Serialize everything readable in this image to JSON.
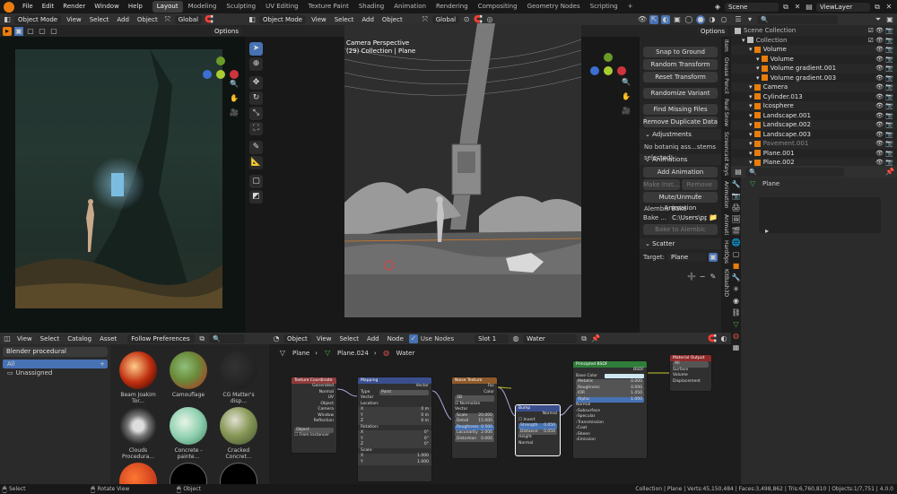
{
  "menus": [
    "File",
    "Edit",
    "Render",
    "Window",
    "Help"
  ],
  "workspaces": [
    "Layout",
    "Modeling",
    "Sculpting",
    "UV Editing",
    "Texture Paint",
    "Shading",
    "Animation",
    "Rendering",
    "Compositing",
    "Geometry Nodes",
    "Scripting"
  ],
  "active_workspace": "Layout",
  "add_tab": "+",
  "scene": {
    "name": "Scene",
    "view_layer": "ViewLayer"
  },
  "left_viewport": {
    "mode": "Object Mode",
    "menus": [
      "View",
      "Select",
      "Add",
      "Object"
    ],
    "transform": "Global",
    "options": "Options"
  },
  "main_viewport": {
    "mode": "Object Mode",
    "menus": [
      "View",
      "Select",
      "Add",
      "Object"
    ],
    "transform": "Global",
    "options": "Options",
    "camera_label": "Camera Perspective",
    "collection_label": "(29) Collection | Plane"
  },
  "npanel": {
    "buttons1": [
      "Snap to Ground",
      "Random Transform",
      "Reset Transform"
    ],
    "randomize": "Randomize Variant",
    "buttons2": [
      "Find Missing Files",
      "Remove Duplicate Data"
    ],
    "adjustments": "Adjustments",
    "no_assets": "No botaniq ass...stems selected!",
    "animations": "Animations",
    "add_animation": "Add Animation",
    "make_inst": "Make Inst...",
    "remove_a": "Remove A...",
    "mute_unmute": "Mute/Unmute Animation",
    "alembic_bake": "Alembic Bake",
    "bake_label": "Bake ...",
    "bake_path": "C:\\Users\\pplao\\b...",
    "bake_to_alembic": "Bake to Alembic",
    "scatter": "Scatter",
    "target_label": "Target:",
    "target_value": "Plane",
    "tabs": [
      "Item",
      "Grease Pencil",
      "Real Snow",
      "Screencast Keys",
      "Animation",
      "Animati",
      "HardOps",
      "KitBash3D"
    ]
  },
  "outliner": {
    "search_placeholder": "",
    "rows": [
      {
        "label": "Scene Collection",
        "indent": 0,
        "color": "#bbbbbb"
      },
      {
        "label": "Collection",
        "indent": 1,
        "color": "#bbbbbb"
      },
      {
        "label": "Volume",
        "indent": 2,
        "color": "#e0e0e0"
      },
      {
        "label": "Volume",
        "indent": 3,
        "color": "#e0e0e0"
      },
      {
        "label": "Volume gradient.001",
        "indent": 3,
        "color": "#e0e0e0"
      },
      {
        "label": "Volume gradient.003",
        "indent": 3,
        "color": "#e0e0e0"
      },
      {
        "label": "Camera",
        "indent": 2,
        "color": "#e0e0e0"
      },
      {
        "label": "Cylinder.013",
        "indent": 2,
        "color": "#e0e0e0"
      },
      {
        "label": "Icosphere",
        "indent": 2,
        "color": "#e0e0e0"
      },
      {
        "label": "Landscape.001",
        "indent": 2,
        "color": "#e0e0e0"
      },
      {
        "label": "Landscape.002",
        "indent": 2,
        "color": "#e0e0e0"
      },
      {
        "label": "Landscape.003",
        "indent": 2,
        "color": "#e0e0e0"
      },
      {
        "label": "Pavement.001",
        "indent": 2,
        "color": "#888888"
      },
      {
        "label": "Plane.001",
        "indent": 2,
        "color": "#e0e0e0"
      },
      {
        "label": "Plane.002",
        "indent": 2,
        "color": "#e0e0e0"
      }
    ]
  },
  "properties": {
    "object_name": "Plane"
  },
  "asset_browser": {
    "menus": [
      "View",
      "Select",
      "Catalog",
      "Asset"
    ],
    "library": "Follow Preferences",
    "source": "Blender procedural",
    "catalogs": [
      "All",
      "Unassigned"
    ],
    "assets": [
      "Beam Joakim Tor...",
      "Camouflage",
      "CG Matter's disp...",
      "Clouds Procedura...",
      "Concrete - painte...",
      "Cracked Concret..."
    ]
  },
  "node_editor": {
    "object_dd": "Object",
    "menus": [
      "View",
      "Select",
      "Add",
      "Node"
    ],
    "use_nodes": "Use Nodes",
    "slot": "Slot 1",
    "material": "Water",
    "breadcrumb": [
      "Plane",
      "Plane.024",
      "Water"
    ],
    "nodes": {
      "texcoord": {
        "title": "Texture Coordinate",
        "outs": [
          "Generated",
          "Normal",
          "UV",
          "Object",
          "Camera",
          "Window",
          "Reflection"
        ],
        "object": "Object",
        "from_instancer": "From Instancer"
      },
      "mapping": {
        "title": "Mapping",
        "vector": "Vector",
        "type_label": "Type",
        "type": "Point",
        "rows": [
          "Vector",
          "Location:",
          "X",
          "Y",
          "Z",
          "Rotation:",
          "X",
          "Y",
          "Z",
          "Scale:",
          "X",
          "Y"
        ],
        "vals": [
          "",
          "",
          "0 m",
          "0 m",
          "0 m",
          "",
          "0°",
          "0°",
          "0°",
          "",
          "1.000",
          "1.000"
        ]
      },
      "noise": {
        "title": "Noise Texture",
        "outs": [
          "Fac",
          "Color"
        ],
        "dim": "3D",
        "normalize": "Normalize",
        "vector": "Vector",
        "params": [
          [
            "Scale",
            "20.000"
          ],
          [
            "Detail",
            "15.000"
          ],
          [
            "Roughness",
            "0.500"
          ],
          [
            "Lacunarity",
            "2.000"
          ],
          [
            "Distortion",
            "0.000"
          ]
        ]
      },
      "bump": {
        "title": "Bump",
        "out": "Normal",
        "invert": "Invert",
        "params": [
          [
            "Strength",
            "0.050"
          ],
          [
            "Distance",
            "0.050"
          ]
        ],
        "height": "Height",
        "normal": "Normal"
      },
      "bsdf": {
        "title": "Principled BSDF",
        "out": "BSDF",
        "base_color": "Base Color",
        "params": [
          [
            "Metallic",
            "0.000"
          ],
          [
            "Roughness",
            "0.000"
          ],
          [
            "IOR",
            "1.450"
          ],
          [
            "Alpha",
            "1.000"
          ]
        ],
        "normal": "Normal",
        "sections": [
          "Subsurface",
          "Specular",
          "Transmission",
          "Coat",
          "Sheen",
          "Emission"
        ]
      },
      "output": {
        "title": "Material Output",
        "target": "All",
        "ins": [
          "Surface",
          "Volume",
          "Displacement"
        ]
      }
    }
  },
  "status": {
    "left": [
      "Select",
      "Rotate View",
      "Object"
    ],
    "right": "Collection | Plane | Verts:45,150,484 | Faces:3,498,862 | Tris:6,760,810 | Objects:1/7,751 | 4.0.0"
  },
  "colors": {
    "accent": "#4772b3",
    "orange": "#e87d0d",
    "header": "#303030",
    "tex_node": "#8f3b3b",
    "vec_node": "#3b4f8f",
    "bsdf_node": "#2f7d3a",
    "out_node": "#8f2a2a"
  }
}
